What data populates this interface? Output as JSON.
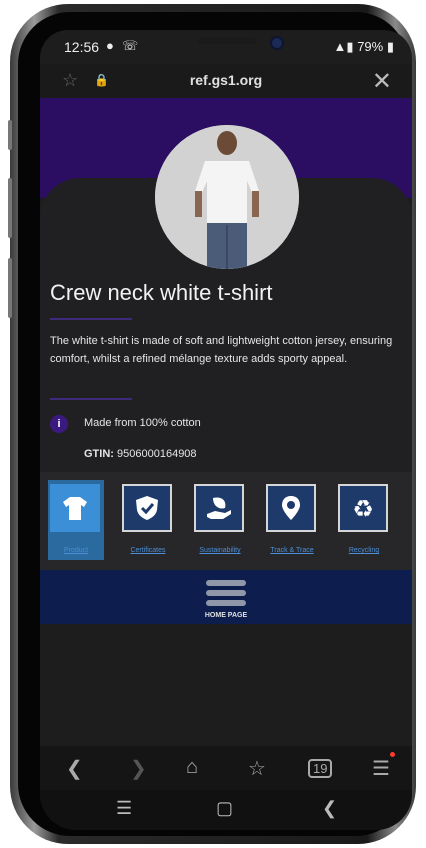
{
  "status": {
    "time": "12:56",
    "battery": "79%"
  },
  "browser": {
    "url": "ref.gs1.org"
  },
  "product": {
    "title": "Crew neck white t-shirt",
    "description": "The white t-shirt is made of soft and lightweight cotton jersey, ensuring comfort, whilst a refined mélange texture adds sporty appeal.",
    "info_icon": "i",
    "info": "Made from 100% cotton",
    "gtin_label": "GTIN:",
    "gtin_value": "9506000164908"
  },
  "tabs": [
    {
      "label": "Product",
      "icon": "tshirt-icon",
      "active": true
    },
    {
      "label": "Certificates",
      "icon": "shield-check-icon",
      "active": false
    },
    {
      "label": "Sustainability",
      "icon": "hand-leaf-icon",
      "active": false
    },
    {
      "label": "Track & Trace",
      "icon": "location-pin-icon",
      "active": false
    },
    {
      "label": "Recycling",
      "icon": "recycle-icon",
      "active": false
    }
  ],
  "home": {
    "label": "HOME PAGE"
  },
  "nav": {
    "tabs_count": "19"
  },
  "colors": {
    "hero": "#2b0d62",
    "tile": "#1d3a6b",
    "active_tile": "#3a8fd6",
    "home_bar": "#0c1d4e",
    "link": "#4a8fd8"
  }
}
